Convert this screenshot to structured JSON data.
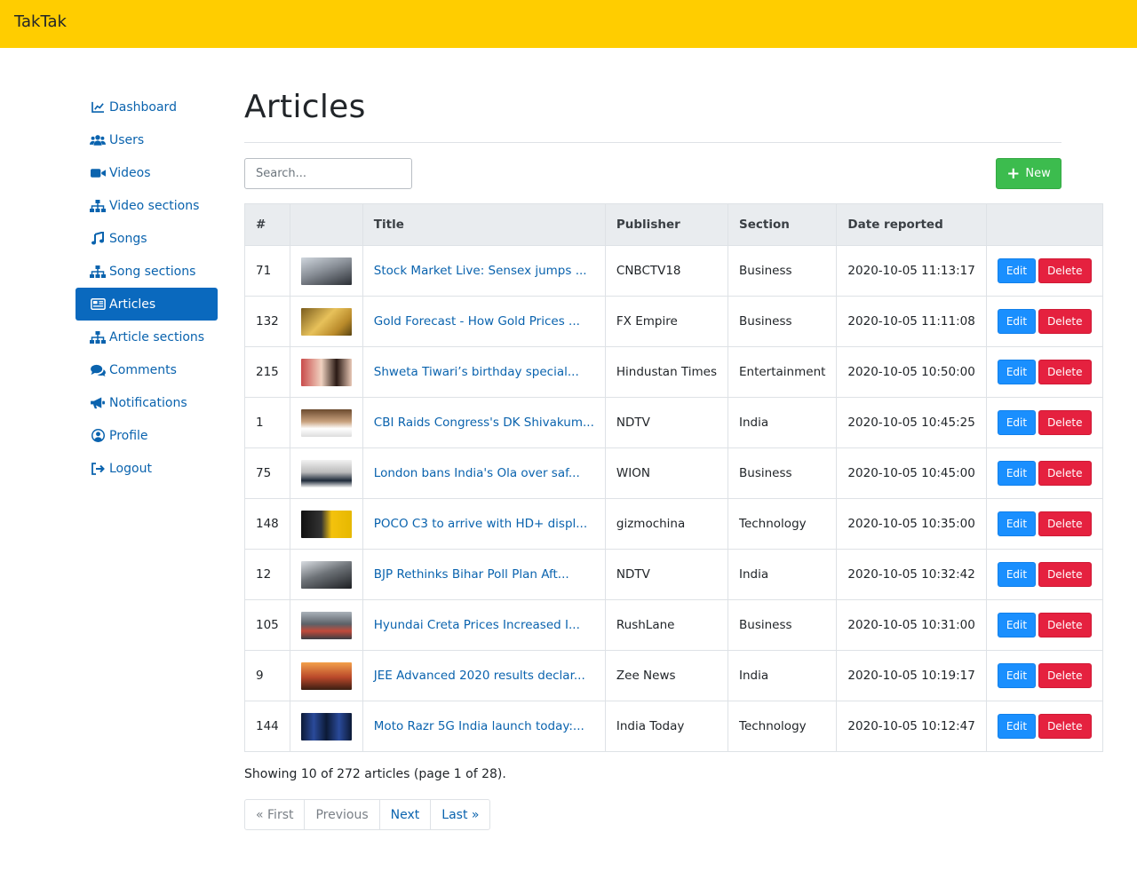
{
  "app": {
    "brand": "TakTak"
  },
  "sidebar": {
    "items": [
      {
        "label": "Dashboard",
        "icon": "chart-line-icon"
      },
      {
        "label": "Users",
        "icon": "users-icon"
      },
      {
        "label": "Videos",
        "icon": "video-camera-icon"
      },
      {
        "label": "Video sections",
        "icon": "sitemap-icon"
      },
      {
        "label": "Songs",
        "icon": "music-note-icon"
      },
      {
        "label": "Song sections",
        "icon": "sitemap-icon"
      },
      {
        "label": "Articles",
        "icon": "newspaper-icon",
        "active": true
      },
      {
        "label": "Article sections",
        "icon": "sitemap-icon"
      },
      {
        "label": "Comments",
        "icon": "comments-icon"
      },
      {
        "label": "Notifications",
        "icon": "bullhorn-icon"
      },
      {
        "label": "Profile",
        "icon": "user-circle-icon"
      },
      {
        "label": "Logout",
        "icon": "sign-out-icon"
      }
    ]
  },
  "main": {
    "title": "Articles",
    "search": {
      "placeholder": "Search..."
    },
    "new_label": "New"
  },
  "table": {
    "headers": [
      "#",
      "",
      "Title",
      "Publisher",
      "Section",
      "Date reported",
      ""
    ],
    "edit_label": "Edit",
    "delete_label": "Delete",
    "rows": [
      {
        "id": "71",
        "title": "Stock Market Live: Sensex jumps ...",
        "publisher": "CNBCTV18",
        "section": "Business",
        "date": "2020-10-05 11:13:17"
      },
      {
        "id": "132",
        "title": "Gold Forecast - How Gold Prices ...",
        "publisher": "FX Empire",
        "section": "Business",
        "date": "2020-10-05 11:11:08"
      },
      {
        "id": "215",
        "title": "Shweta Tiwari’s birthday special...",
        "publisher": "Hindustan Times",
        "section": "Entertainment",
        "date": "2020-10-05 10:50:00"
      },
      {
        "id": "1",
        "title": "CBI Raids Congress's DK Shivakum...",
        "publisher": "NDTV",
        "section": "India",
        "date": "2020-10-05 10:45:25"
      },
      {
        "id": "75",
        "title": "London bans India's Ola over saf...",
        "publisher": "WION",
        "section": "Business",
        "date": "2020-10-05 10:45:00"
      },
      {
        "id": "148",
        "title": "POCO C3 to arrive with HD+ displ...",
        "publisher": "gizmochina",
        "section": "Technology",
        "date": "2020-10-05 10:35:00"
      },
      {
        "id": "12",
        "title": "BJP Rethinks Bihar Poll Plan Aft...",
        "publisher": "NDTV",
        "section": "India",
        "date": "2020-10-05 10:32:42"
      },
      {
        "id": "105",
        "title": "Hyundai Creta Prices Increased I...",
        "publisher": "RushLane",
        "section": "Business",
        "date": "2020-10-05 10:31:00"
      },
      {
        "id": "9",
        "title": "JEE Advanced 2020 results declar...",
        "publisher": "Zee News",
        "section": "India",
        "date": "2020-10-05 10:19:17"
      },
      {
        "id": "144",
        "title": "Moto Razr 5G India launch today:...",
        "publisher": "India Today",
        "section": "Technology",
        "date": "2020-10-05 10:12:47"
      }
    ]
  },
  "summary": "Showing 10 of 272 articles (page 1 of 28).",
  "pagination": {
    "first": "« First",
    "previous": "Previous",
    "next": "Next",
    "last": "Last »"
  },
  "colors": {
    "topbar": "#ffcd00",
    "accent": "#0a63ae",
    "active": "#0a69be",
    "new": "#3cbc4e",
    "edit": "#1a8ffe",
    "delete": "#e5213f"
  }
}
